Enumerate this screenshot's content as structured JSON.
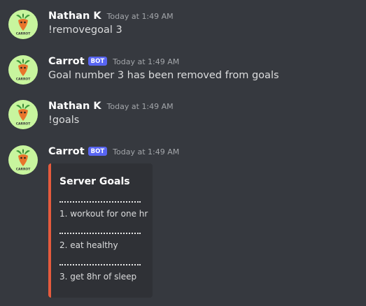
{
  "messages": [
    {
      "author": "Nathan K",
      "timestamp": "Today at 1:49 AM",
      "text": "!removegoal 3",
      "avatar_icon": "carrot-icon"
    },
    {
      "author": "Carrot",
      "badge": "BOT",
      "timestamp": "Today at 1:49 AM",
      "text": "Goal number 3 has been removed from goals",
      "avatar_icon": "carrot-icon"
    },
    {
      "author": "Nathan K",
      "timestamp": "Today at 1:49 AM",
      "text": "!goals",
      "avatar_icon": "carrot-icon"
    },
    {
      "author": "Carrot",
      "badge": "BOT",
      "timestamp": "Today at 1:49 AM",
      "avatar_icon": "carrot-icon"
    }
  ],
  "embed": {
    "title": "Server Goals",
    "separator": "..................................",
    "goals": [
      "1. workout for one hr",
      "2. eat healthy",
      "3. get 8hr of sleep"
    ],
    "accent_color": "#e65b3d"
  },
  "avatar_label": "CARROT",
  "colors": {
    "background": "#36393f",
    "bot_badge": "#5865f2",
    "embed_bg": "#2f3136",
    "avatar_bg": "#c8f59e"
  }
}
